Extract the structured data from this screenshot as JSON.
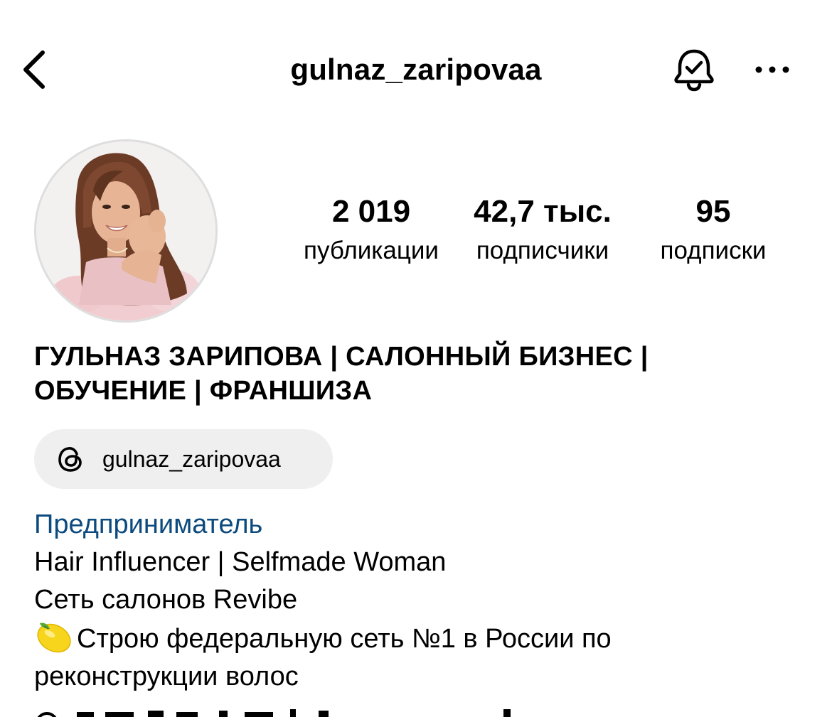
{
  "header": {
    "username": "gulnaz_zaripovaa",
    "back_icon": "chevron-left-icon",
    "notify_icon": "bell-check-icon",
    "more_icon": "more-horizontal-icon"
  },
  "profile": {
    "stats": {
      "posts_value": "2 019",
      "posts_label": "публикации",
      "followers_value": "42,7 тыс.",
      "followers_label": "подписчики",
      "following_value": "95",
      "following_label": "подписки"
    },
    "full_name": "ГУЛЬНАЗ ЗАРИПОВА | САЛОННЫЙ БИЗНЕС | ОБУЧЕНИЕ | ФРАНШИЗА",
    "threads": {
      "icon": "threads-icon",
      "handle": "gulnaz_zaripovaa"
    },
    "bio": {
      "category": "Предприниматель",
      "line1": "Hair Influencer | Selfmade Woman",
      "line2": "Сеть салонов Revibe",
      "line3_emoji": "lemon-emoji-icon",
      "line3": "Строю федеральную сеть №1 в России по",
      "line4": "реконструкции волос"
    }
  },
  "colors": {
    "category_link": "#0d4b7f",
    "pill_background": "#efefef",
    "text": "#000000"
  }
}
